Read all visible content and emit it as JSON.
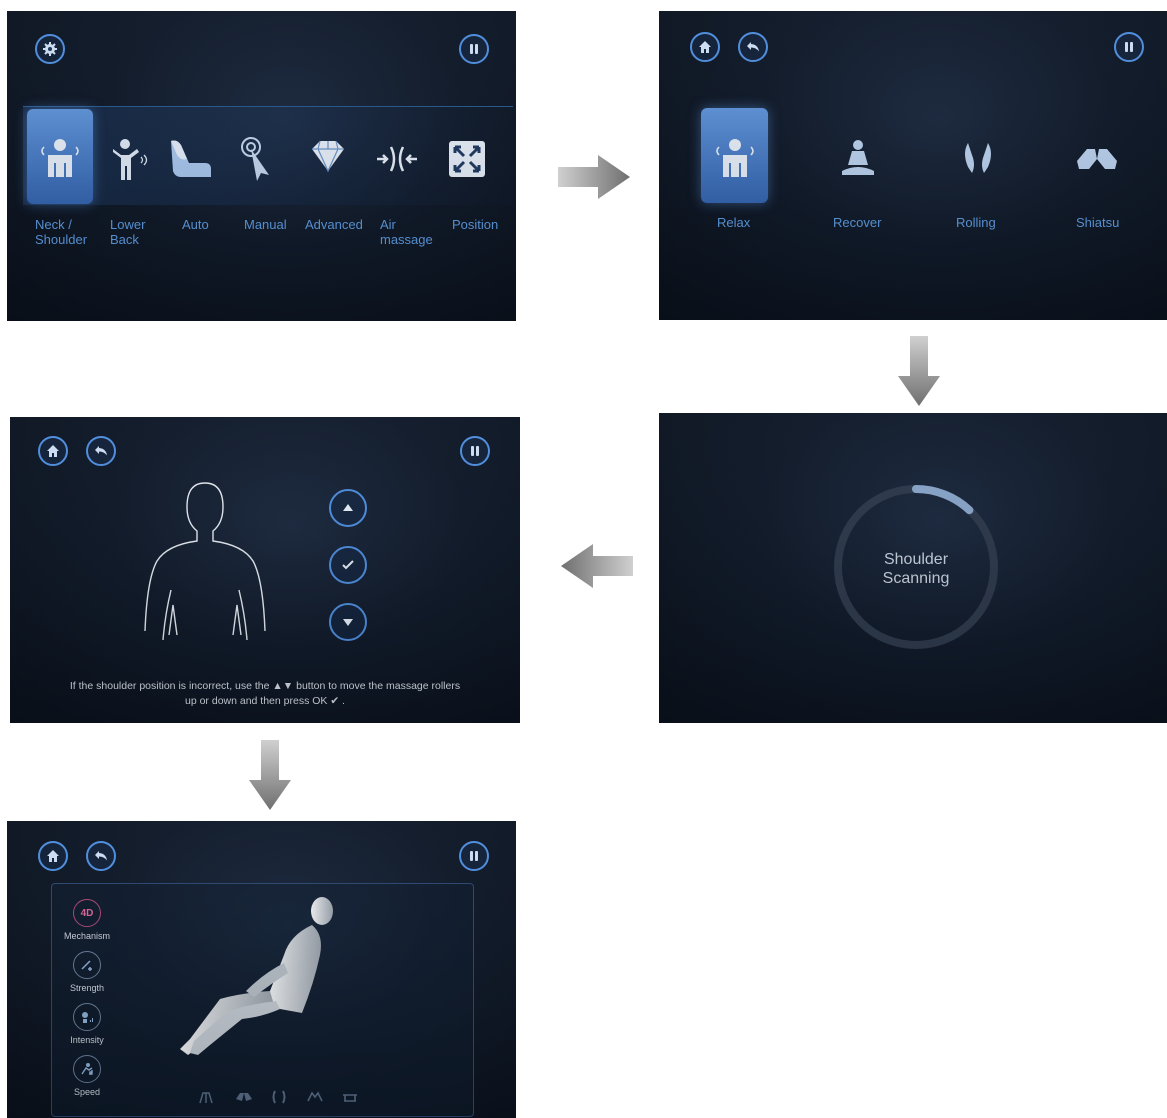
{
  "screen1": {
    "menu_items": [
      {
        "label": "Neck / Shoulder",
        "icon": "neck-shoulder-icon"
      },
      {
        "label": "Lower Back",
        "icon": "lower-back-icon"
      },
      {
        "label": "Auto",
        "icon": "massage-chair-icon"
      },
      {
        "label": "Manual",
        "icon": "manual-touch-icon"
      },
      {
        "label": "Advanced",
        "icon": "diamond-icon"
      },
      {
        "label": "Air massage",
        "icon": "air-massage-icon"
      },
      {
        "label": "Position",
        "icon": "position-expand-icon"
      }
    ],
    "selected_index": 0
  },
  "screen2": {
    "programs": [
      {
        "label": "Relax",
        "icon": "relax-icon"
      },
      {
        "label": "Recover",
        "icon": "recover-meditation-icon"
      },
      {
        "label": "Rolling",
        "icon": "rolling-icon"
      },
      {
        "label": "Shiatsu",
        "icon": "shiatsu-hands-icon"
      }
    ],
    "selected_index": 0
  },
  "screen3": {
    "scan_line1": "Shoulder",
    "scan_line2": "Scanning",
    "progress": 0.12
  },
  "screen4": {
    "instruction_line1": "If the shoulder position is incorrect, use the ▲▼ button to move the massage rollers",
    "instruction_line2": "up or down and then press OK ✔ ."
  },
  "screen5": {
    "mechanism_badge": "4D",
    "controls": [
      {
        "label": "Mechanism",
        "icon": "4d-icon"
      },
      {
        "label": "Strength",
        "icon": "strength-icon"
      },
      {
        "label": "Intensity",
        "icon": "intensity-icon"
      },
      {
        "label": "Speed",
        "icon": "speed-icon"
      }
    ]
  },
  "colors": {
    "accent": "#4f8fe0",
    "label": "#5e9ee6",
    "selected_tile": "#4a80cc",
    "arrow": "#8a8a8a"
  }
}
